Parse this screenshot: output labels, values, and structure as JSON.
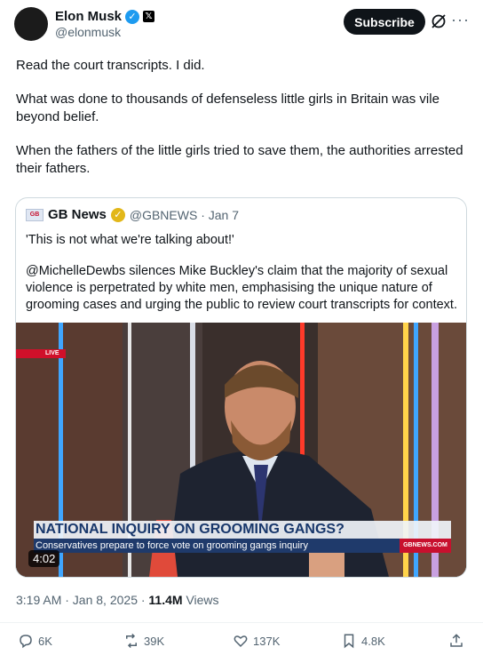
{
  "author": {
    "name": "Elon Musk",
    "handle": "@elonmusk",
    "verified_glyph": "✓",
    "x_badge": "𝕏"
  },
  "header_actions": {
    "subscribe_label": "Subscribe",
    "grok_icon": "grok-icon",
    "more_glyph": "···"
  },
  "tweet": {
    "paragraphs": [
      "Read the court transcripts. I did.",
      "What was done to thousands of defenseless little girls in Britain was vile beyond belief.",
      "When the fathers of the little girls tried to save them, the authorities arrested their fathers."
    ]
  },
  "quote": {
    "logo_text": "GB",
    "name": "GB News",
    "check_glyph": "✓",
    "handle_date": "@GBNEWS · Jan 7",
    "paragraphs": [
      "'This is not what we're talking about!'",
      "@MichelleDewbs silences Mike Buckley's claim that the majority of sexual violence is perpetrated by white men, emphasising the unique nature of grooming cases and urging the public to review court transcripts for context."
    ],
    "video": {
      "live_label": "LIVE",
      "headline": "NATIONAL INQUIRY ON GROOMING GANGS?",
      "subline": "Conservatives prepare to force vote on grooming gangs inquiry",
      "site": "GBNEWS.COM",
      "duration": "4:02"
    }
  },
  "meta": {
    "time": "3:19 AM · Jan 8, 2025 · ",
    "views_count": "11.4M",
    "views_label": " Views"
  },
  "actions": {
    "replies": "6K",
    "reposts": "39K",
    "likes": "137K",
    "bookmarks": "4.8K"
  },
  "colors": {
    "accent": "#1d9bf0",
    "gold": "#e2b719",
    "text": "#0f1419",
    "secondary": "#536471"
  }
}
